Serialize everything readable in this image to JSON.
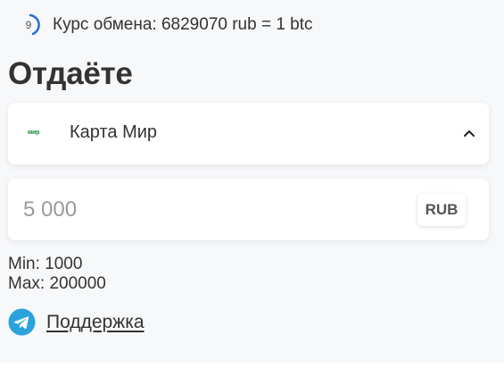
{
  "rate": {
    "timer_value": "9",
    "text": "Курс обмена: 6829070 rub = 1 btc"
  },
  "give": {
    "title": "Отдаёте",
    "method": {
      "logo_text": "мир",
      "label": "Карта Мир",
      "expanded": true
    },
    "amount": {
      "placeholder": "5 000",
      "value": "",
      "currency": "RUB"
    },
    "limits": {
      "min": "Min: 1000",
      "max": "Max: 200000"
    }
  },
  "support": {
    "label": "Поддержка"
  },
  "colors": {
    "timer_accent": "#2e6bd6",
    "telegram": "#2aa3dd",
    "mir_green": "#1a8a3a",
    "panel_bg": "#f7f8fa"
  },
  "icons": {
    "timer": "countdown-ring-icon",
    "method": "mir-logo-icon",
    "toggle": "chevron-up-icon",
    "support": "telegram-icon"
  }
}
